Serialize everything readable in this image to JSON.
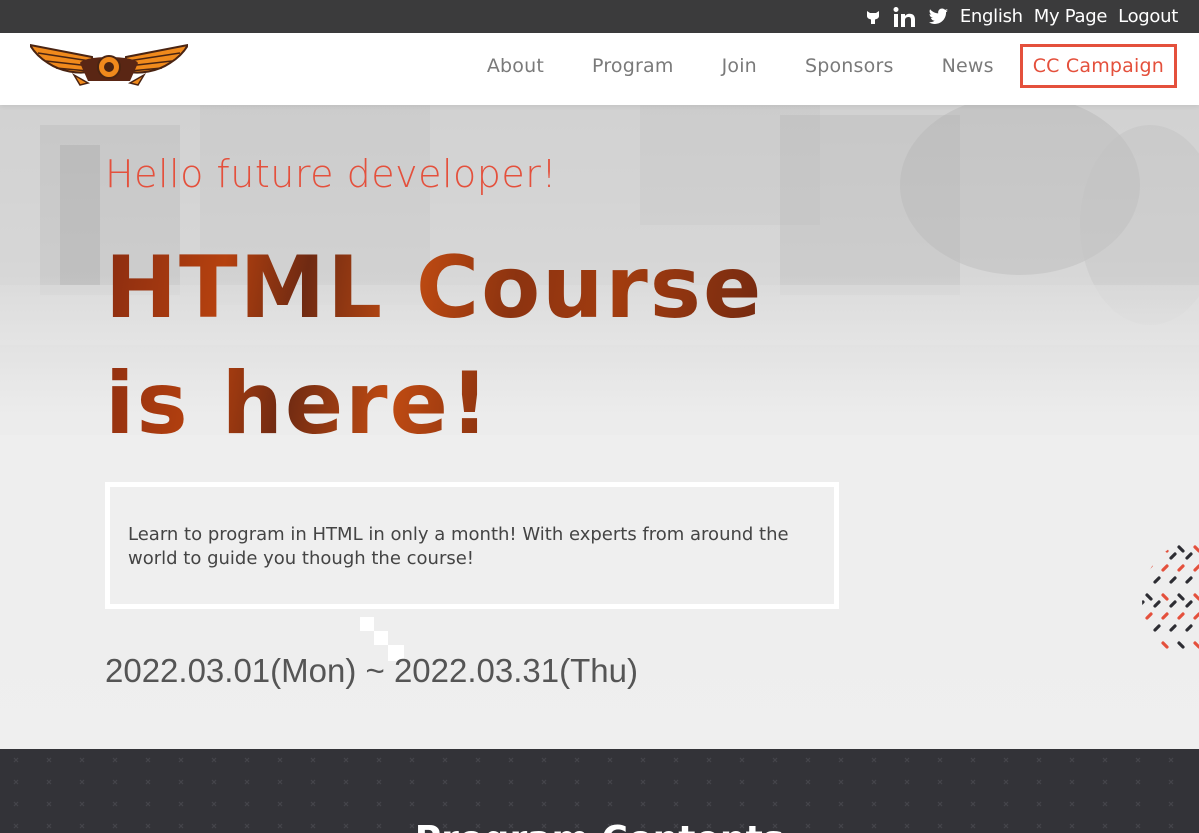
{
  "topbar": {
    "icons": [
      "github-icon",
      "linkedin-icon",
      "twitter-icon"
    ],
    "links": [
      "English",
      "My Page",
      "Logout"
    ]
  },
  "nav": {
    "items": [
      "About",
      "Program",
      "Join",
      "Sponsors",
      "News"
    ],
    "cta": "CC Campaign"
  },
  "hero": {
    "greeting": "Hello future developer!",
    "headline_line1": "HTML Course",
    "headline_line2": "is here!",
    "description": "Learn to program in HTML in only a month! With experts from around the world to guide you though the course!",
    "dates": "2022.03.01(Mon) ~ 2022.03.31(Thu)"
  },
  "section": {
    "title": "Program Contents"
  },
  "colors": {
    "accent": "#e4503c",
    "topbar": "#3b3b3c",
    "dark_section": "#333338",
    "headline_brown": "#8a2c10"
  }
}
